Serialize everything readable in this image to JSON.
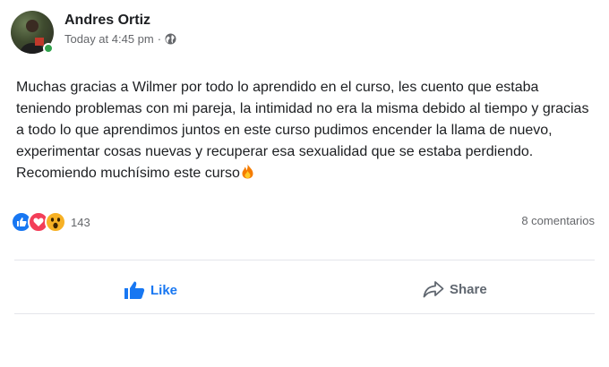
{
  "post": {
    "author": "Andres Ortiz",
    "timestamp": "Today at 4:45 pm",
    "separator": "·",
    "text": "Muchas gracias a Wilmer por todo lo aprendido en el curso, les cuento que estaba teniendo problemas con mi pareja, la intimidad no era la misma debido al tiempo y gracias a todo lo que aprendimos juntos en este curso pudimos encender la llama de nuevo, experimentar cosas nuevas y recuperar esa sexualidad que se estaba perdiendo. Recomiendo muchísimo este curso",
    "audience_icon": "globe-icon",
    "emoji_icon": "fire-icon"
  },
  "reactions": {
    "types": [
      "like",
      "love",
      "wow"
    ],
    "count": "143"
  },
  "comments": {
    "label": "8 comentarios"
  },
  "actions": {
    "like_label": "Like",
    "share_label": "Share"
  },
  "colors": {
    "like_blue": "#1877f2",
    "love_red": "#f33e58",
    "wow_yellow": "#f7b125",
    "online_green": "#31a24c",
    "muted_text": "#65676b"
  }
}
